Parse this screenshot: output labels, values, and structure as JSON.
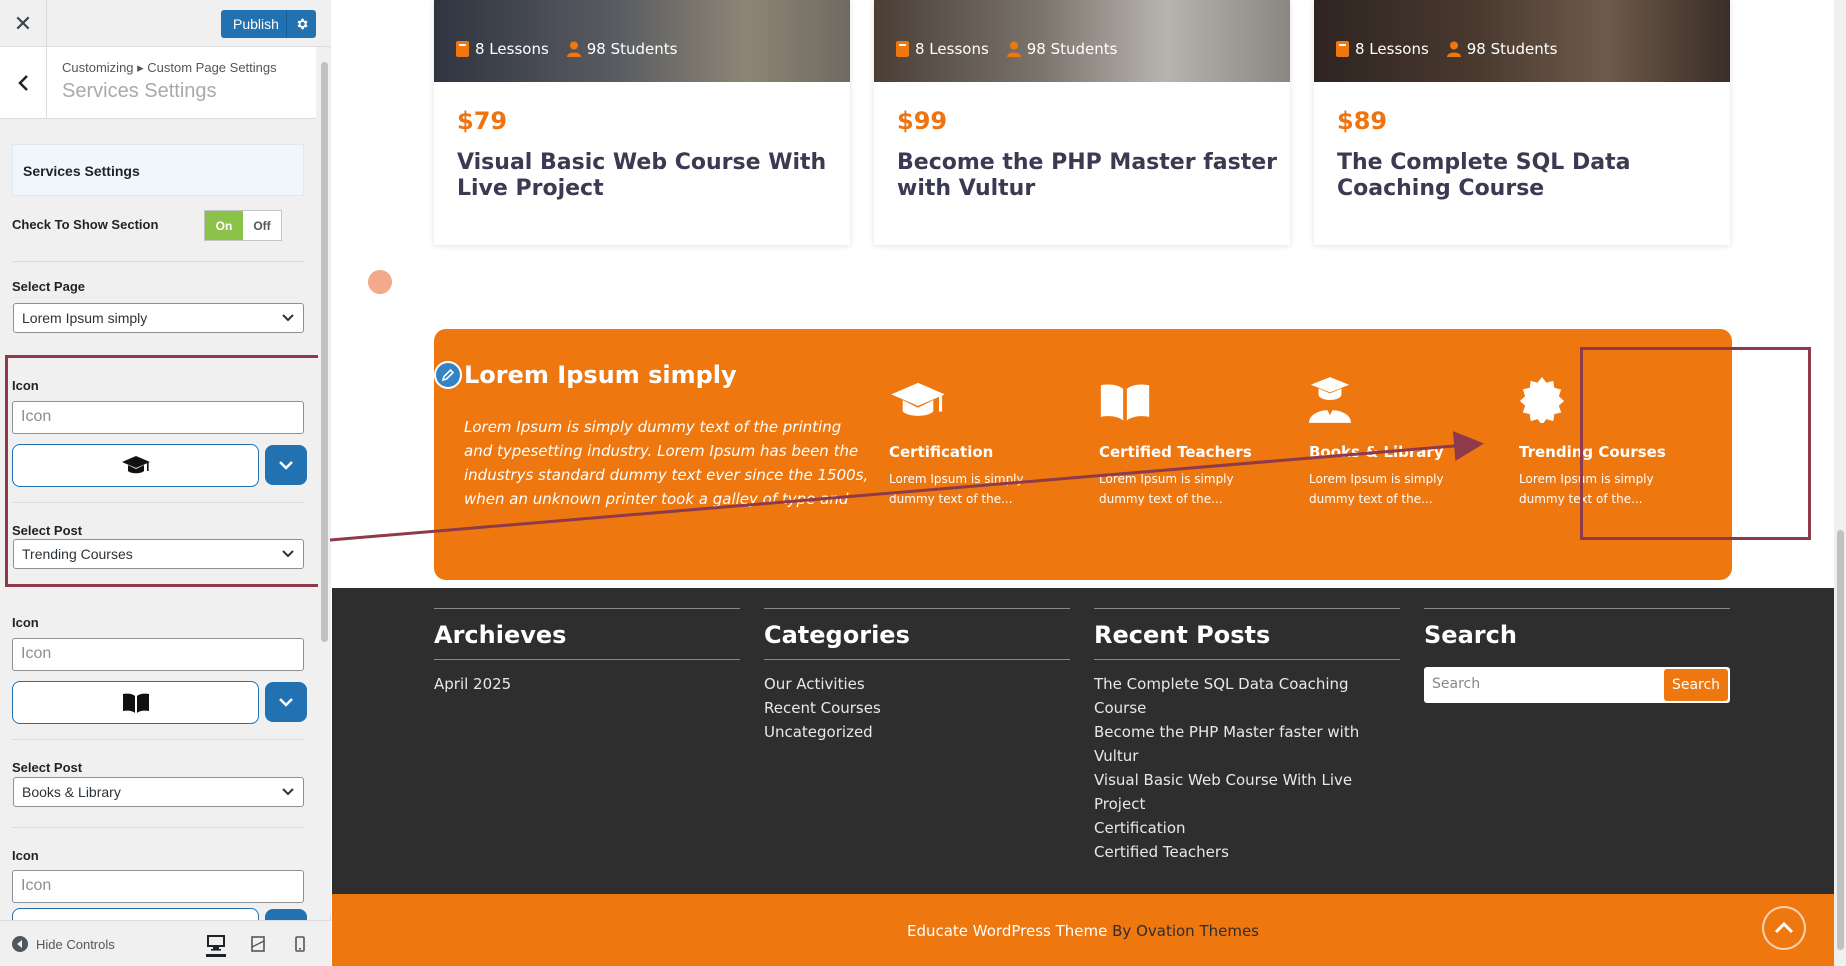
{
  "topbar": {
    "close_symbol": "✕",
    "publish_label": "Publish"
  },
  "section": {
    "breadcrumb": "Customizing ▸ Custom Page Settings",
    "title": "Services Settings"
  },
  "controls": {
    "heading": "Services Settings",
    "show_section_label": "Check To Show Section",
    "toggle_on": "On",
    "toggle_off": "Off",
    "select_page_label": "Select Page",
    "select_page_value": "Lorem Ipsum simply",
    "icon_label": "Icon",
    "icon_placeholder": "Icon",
    "select_post_label": "Select Post",
    "post_1_value": "Trending Courses",
    "post_2_value": "Books & Library"
  },
  "footerbar": {
    "hide_controls": "Hide Controls"
  },
  "courses": [
    {
      "lessons": "8 Lessons",
      "students": "98 Students",
      "price": "$79",
      "title": "Visual Basic Web Course With Live Project"
    },
    {
      "lessons": "8 Lessons",
      "students": "98 Students",
      "price": "$99",
      "title": "Become the PHP Master faster with Vultur"
    },
    {
      "lessons": "8 Lessons",
      "students": "98 Students",
      "price": "$89",
      "title": "The Complete SQL Data Coaching Course"
    }
  ],
  "services": {
    "title": "Lorem Ipsum simply",
    "description": "Lorem Ipsum is simply dummy text of the printing and typesetting industry. Lorem Ipsum has been the industrys standard dummy text ever since the 1500s, when an unknown printer took a galley of type and scrambled it to make a...",
    "items": [
      {
        "name": "Certification",
        "text": "Lorem Ipsum is simply dummy text of the...",
        "icon": "graduation-cap-icon"
      },
      {
        "name": "Certified Teachers",
        "text": "Lorem Ipsum is simply dummy text of the...",
        "icon": "open-book-icon"
      },
      {
        "name": "Books & Library",
        "text": "Lorem Ipsum is simply dummy text of the...",
        "icon": "graduate-user-icon"
      },
      {
        "name": "Trending Courses",
        "text": "Lorem Ipsum is simply dummy text of the...",
        "icon": "certificate-badge-icon"
      }
    ]
  },
  "footer": {
    "archives": {
      "heading": "Archieves",
      "links": [
        "April 2025"
      ]
    },
    "categories": {
      "heading": "Categories",
      "links": [
        "Our Activities",
        "Recent Courses",
        "Uncategorized"
      ]
    },
    "recent_posts": {
      "heading": "Recent Posts",
      "links": [
        "The Complete SQL Data Coaching Course",
        "Become the PHP Master faster with Vultur",
        "Visual Basic Web Course With Live Project",
        "Certification",
        "Certified Teachers"
      ]
    },
    "search": {
      "heading": "Search",
      "placeholder": "Search",
      "button": "Search"
    }
  },
  "copyright": {
    "theme": "Educate WordPress Theme",
    "by": " By Ovation Themes"
  },
  "colors": {
    "accent_orange": "#ef770f",
    "wp_blue": "#2271b1",
    "annotation": "#8e3a4a",
    "footer_dark": "#2e2e2e"
  }
}
